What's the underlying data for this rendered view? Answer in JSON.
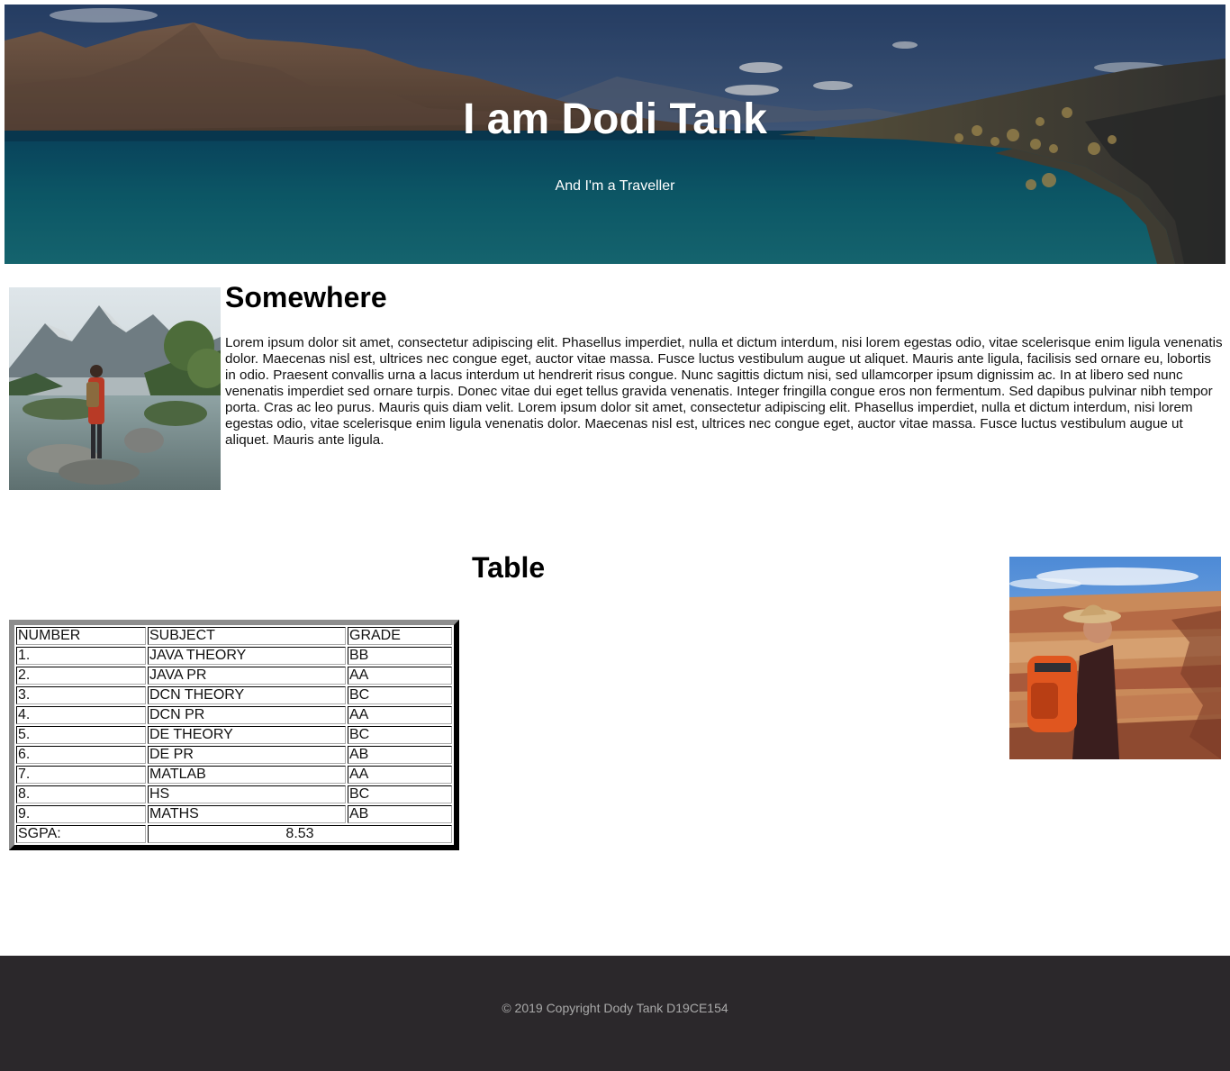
{
  "hero": {
    "title": "I am Dodi Tank",
    "subtitle": "And I'm a Traveller",
    "image": "lake-mountain-landscape"
  },
  "about": {
    "image": "traveller-lake-photo",
    "heading": "Somewhere",
    "body": "Lorem ipsum dolor sit amet, consectetur adipiscing elit. Phasellus imperdiet, nulla et dictum interdum, nisi lorem egestas odio, vitae scelerisque enim ligula venenatis dolor. Maecenas nisl est, ultrices nec congue eget, auctor vitae massa. Fusce luctus vestibulum augue ut aliquet. Mauris ante ligula, facilisis sed ornare eu, lobortis in odio. Praesent convallis urna a lacus interdum ut hendrerit risus congue. Nunc sagittis dictum nisi, sed ullamcorper ipsum dignissim ac. In at libero sed nunc venenatis imperdiet sed ornare turpis. Donec vitae dui eget tellus gravida venenatis. Integer fringilla congue eros non fermentum. Sed dapibus pulvinar nibh tempor porta. Cras ac leo purus. Mauris quis diam velit. Lorem ipsum dolor sit amet, consectetur adipiscing elit. Phasellus imperdiet, nulla et dictum interdum, nisi lorem egestas odio, vitae scelerisque enim ligula venenatis dolor. Maecenas nisl est, ultrices nec congue eget, auctor vitae massa. Fusce luctus vestibulum augue ut aliquet. Mauris ante ligula."
  },
  "table_section": {
    "heading": "Table",
    "side_image": "hiker-canyon-photo",
    "headers": [
      "NUMBER",
      "SUBJECT",
      "GRADE"
    ],
    "rows": [
      [
        "1.",
        "JAVA THEORY",
        "BB"
      ],
      [
        "2.",
        "JAVA PR",
        "AA"
      ],
      [
        "3.",
        "DCN THEORY",
        "BC"
      ],
      [
        "4.",
        "DCN PR",
        "AA"
      ],
      [
        "5.",
        "DE THEORY",
        "BC"
      ],
      [
        "6.",
        "DE PR",
        "AB"
      ],
      [
        "7.",
        "MATLAB",
        "AA"
      ],
      [
        "8.",
        "HS",
        "BC"
      ],
      [
        "9.",
        "MATHS",
        "AB"
      ]
    ],
    "sgpa_label": "SGPA:",
    "sgpa_value": "8.53"
  },
  "footer": {
    "text": "© 2019 Copyright Dody Tank D19CE154",
    "background": "#2b282b"
  }
}
